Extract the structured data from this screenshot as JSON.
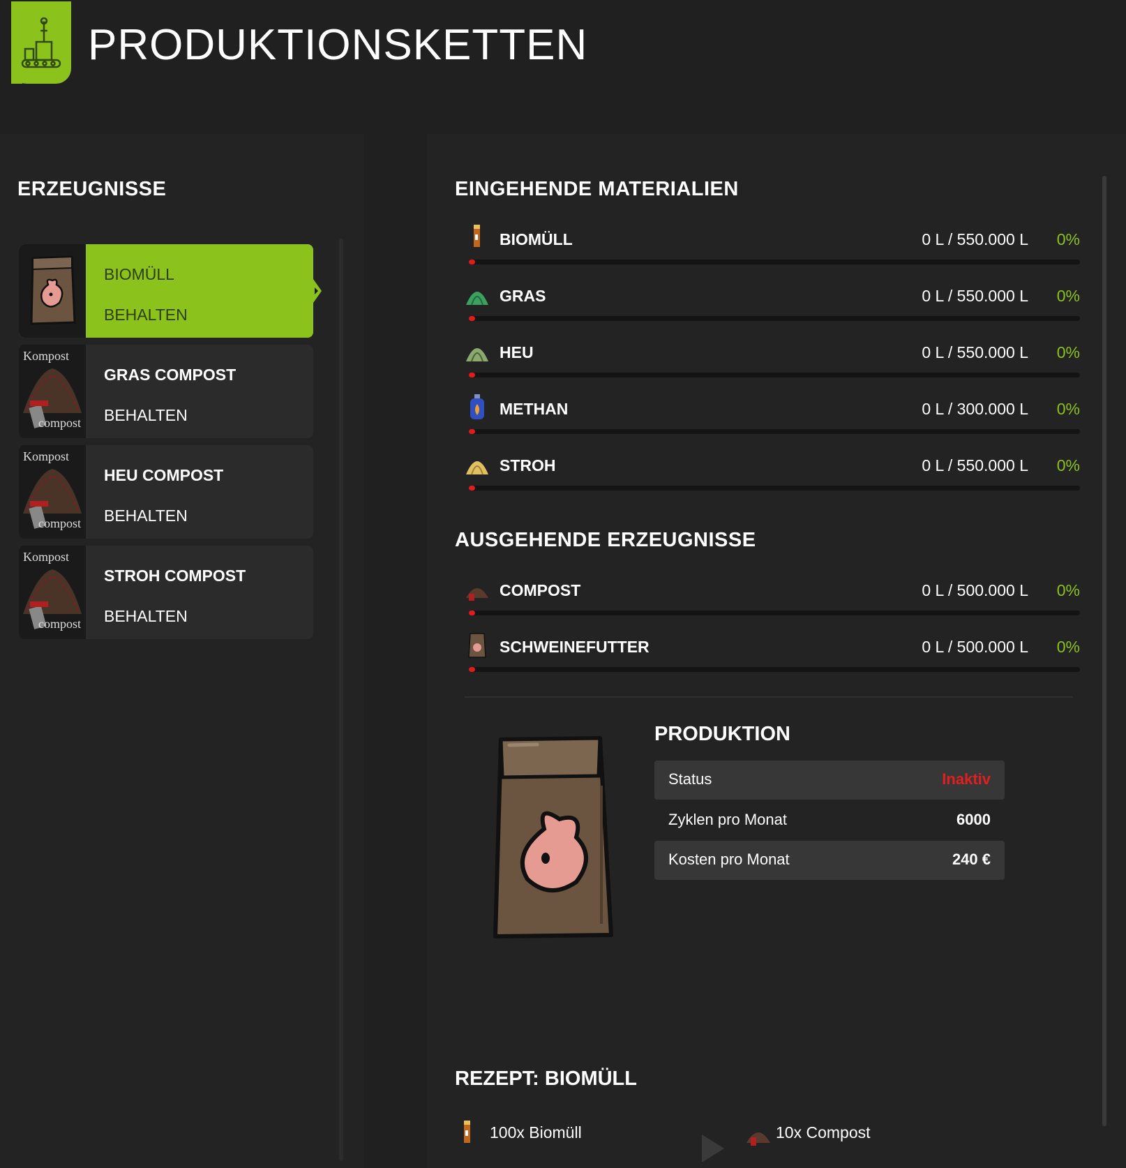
{
  "header": {
    "title": "PRODUKTIONSKETTEN",
    "logo_icon": "production-chain-icon"
  },
  "left": {
    "title": "ERZEUGNISSE",
    "items": [
      {
        "name": "BIOMÜLL",
        "action": "BEHALTEN",
        "selected": true,
        "thumb": "pig-feed-bag-icon"
      },
      {
        "name": "GRAS COMPOST",
        "action": "BEHALTEN",
        "selected": false,
        "thumb": "compost-pile-icon",
        "thumb_top": "Kompost",
        "thumb_bottom": "compost"
      },
      {
        "name": "HEU COMPOST",
        "action": "BEHALTEN",
        "selected": false,
        "thumb": "compost-pile-icon",
        "thumb_top": "Kompost",
        "thumb_bottom": "compost"
      },
      {
        "name": "STROH COMPOST",
        "action": "BEHALTEN",
        "selected": false,
        "thumb": "compost-pile-icon",
        "thumb_top": "Kompost",
        "thumb_bottom": "compost"
      }
    ]
  },
  "incoming": {
    "title": "EINGEHENDE MATERIALIEN",
    "items": [
      {
        "name": "BIOMÜLL",
        "amount": "0 L / 550.000 L",
        "percent": "0%",
        "fill": 0,
        "icon": "biowaste-icon"
      },
      {
        "name": "GRAS",
        "amount": "0 L / 550.000 L",
        "percent": "0%",
        "fill": 0,
        "icon": "grass-icon"
      },
      {
        "name": "HEU",
        "amount": "0 L / 550.000 L",
        "percent": "0%",
        "fill": 0,
        "icon": "hay-icon"
      },
      {
        "name": "METHAN",
        "amount": "0 L / 300.000 L",
        "percent": "0%",
        "fill": 0,
        "icon": "methane-icon"
      },
      {
        "name": "STROH",
        "amount": "0 L / 550.000 L",
        "percent": "0%",
        "fill": 0,
        "icon": "straw-icon"
      }
    ]
  },
  "outgoing": {
    "title": "AUSGEHENDE ERZEUGNISSE",
    "items": [
      {
        "name": "COMPOST",
        "amount": "0 L / 500.000 L",
        "percent": "0%",
        "fill": 0,
        "icon": "compost-icon"
      },
      {
        "name": "SCHWEINEFUTTER",
        "amount": "0 L / 500.000 L",
        "percent": "0%",
        "fill": 0,
        "icon": "pig-feed-icon"
      }
    ]
  },
  "production": {
    "title": "PRODUKTION",
    "image": "pig-feed-bag-icon",
    "status_label": "Status",
    "status_value": "Inaktiv",
    "cycles_label": "Zyklen pro Monat",
    "cycles_value": "6000",
    "cost_label": "Kosten pro Monat",
    "cost_value": "240 €"
  },
  "recipe": {
    "title": "REZEPT: BIOMÜLL",
    "input": "100x Biomüll",
    "output": "10x Compost",
    "arrow_icon": "play-arrow-icon"
  },
  "colors": {
    "accent": "#8cc21c",
    "background": "#202020",
    "panel": "#232323",
    "alert": "#e02020"
  }
}
